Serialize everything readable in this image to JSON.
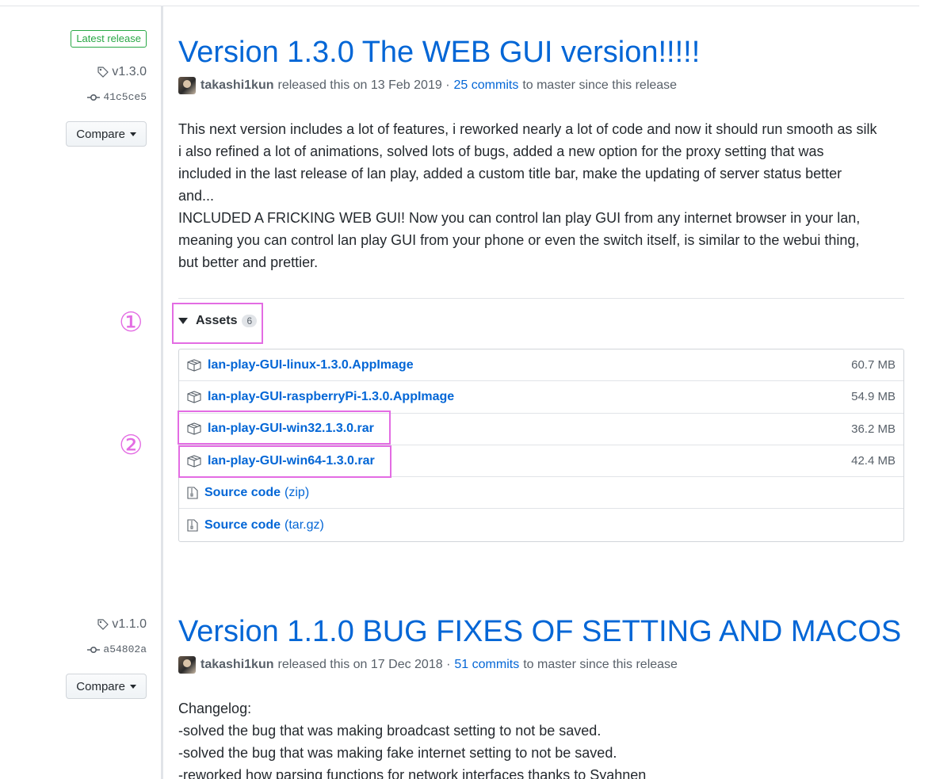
{
  "releases": [
    {
      "latest_label": "Latest release",
      "tag": "v1.3.0",
      "commit": "41c5ce5",
      "compare_label": "Compare",
      "title": "Version 1.3.0 The WEB GUI version!!!!!",
      "author": "takashi1kun",
      "released_text": "released this on 13 Feb 2019 ·",
      "commits_link": "25 commits",
      "commits_suffix": "to master since this release",
      "body_lines": [
        "This next version includes a lot of features, i reworked nearly a lot of code and now it should run smooth as silk",
        "i also refined a lot of animations, solved lots of bugs, added a new option for the proxy setting that was",
        "included in the last release of lan play, added a custom title bar, make the updating of server status better",
        "and...",
        "INCLUDED A FRICKING WEB GUI! Now you can control lan play GUI from any internet browser in your lan,",
        "meaning you can control lan play GUI from your phone or even the switch itself, is similar to the webui thing,",
        "but better and prettier."
      ],
      "assets": {
        "label": "Assets",
        "count": "6",
        "files": [
          {
            "name": "lan-play-GUI-linux-1.3.0.AppImage",
            "size": "60.7 MB"
          },
          {
            "name": "lan-play-GUI-raspberryPi-1.3.0.AppImage",
            "size": "54.9 MB"
          },
          {
            "name": "lan-play-GUI-win32.1.3.0.rar",
            "size": "36.2 MB"
          },
          {
            "name": "lan-play-GUI-win64-1.3.0.rar",
            "size": "42.4 MB"
          }
        ],
        "sources": [
          {
            "name": "Source code",
            "format": "(zip)"
          },
          {
            "name": "Source code",
            "format": "(tar.gz)"
          }
        ]
      }
    },
    {
      "tag": "v1.1.0",
      "commit": "a54802a",
      "compare_label": "Compare",
      "title": "Version 1.1.0 BUG FIXES OF SETTING AND MACOS",
      "author": "takashi1kun",
      "released_text": "released this on 17 Dec 2018 ·",
      "commits_link": "51 commits",
      "commits_suffix": "to master since this release",
      "body_lines": [
        "Changelog:",
        "-solved the bug that was making broadcast setting to not be saved.",
        "-solved the bug that was making fake internet setting to not be saved.",
        "-reworked how parsing functions for network interfaces thanks to Syahnen"
      ]
    }
  ],
  "annotations": {
    "marker_1": "①",
    "marker_2": "②",
    "color": "#e36ce3"
  },
  "colors": {
    "link": "#0366d6",
    "latest_green": "#28a745",
    "muted": "#586069"
  }
}
